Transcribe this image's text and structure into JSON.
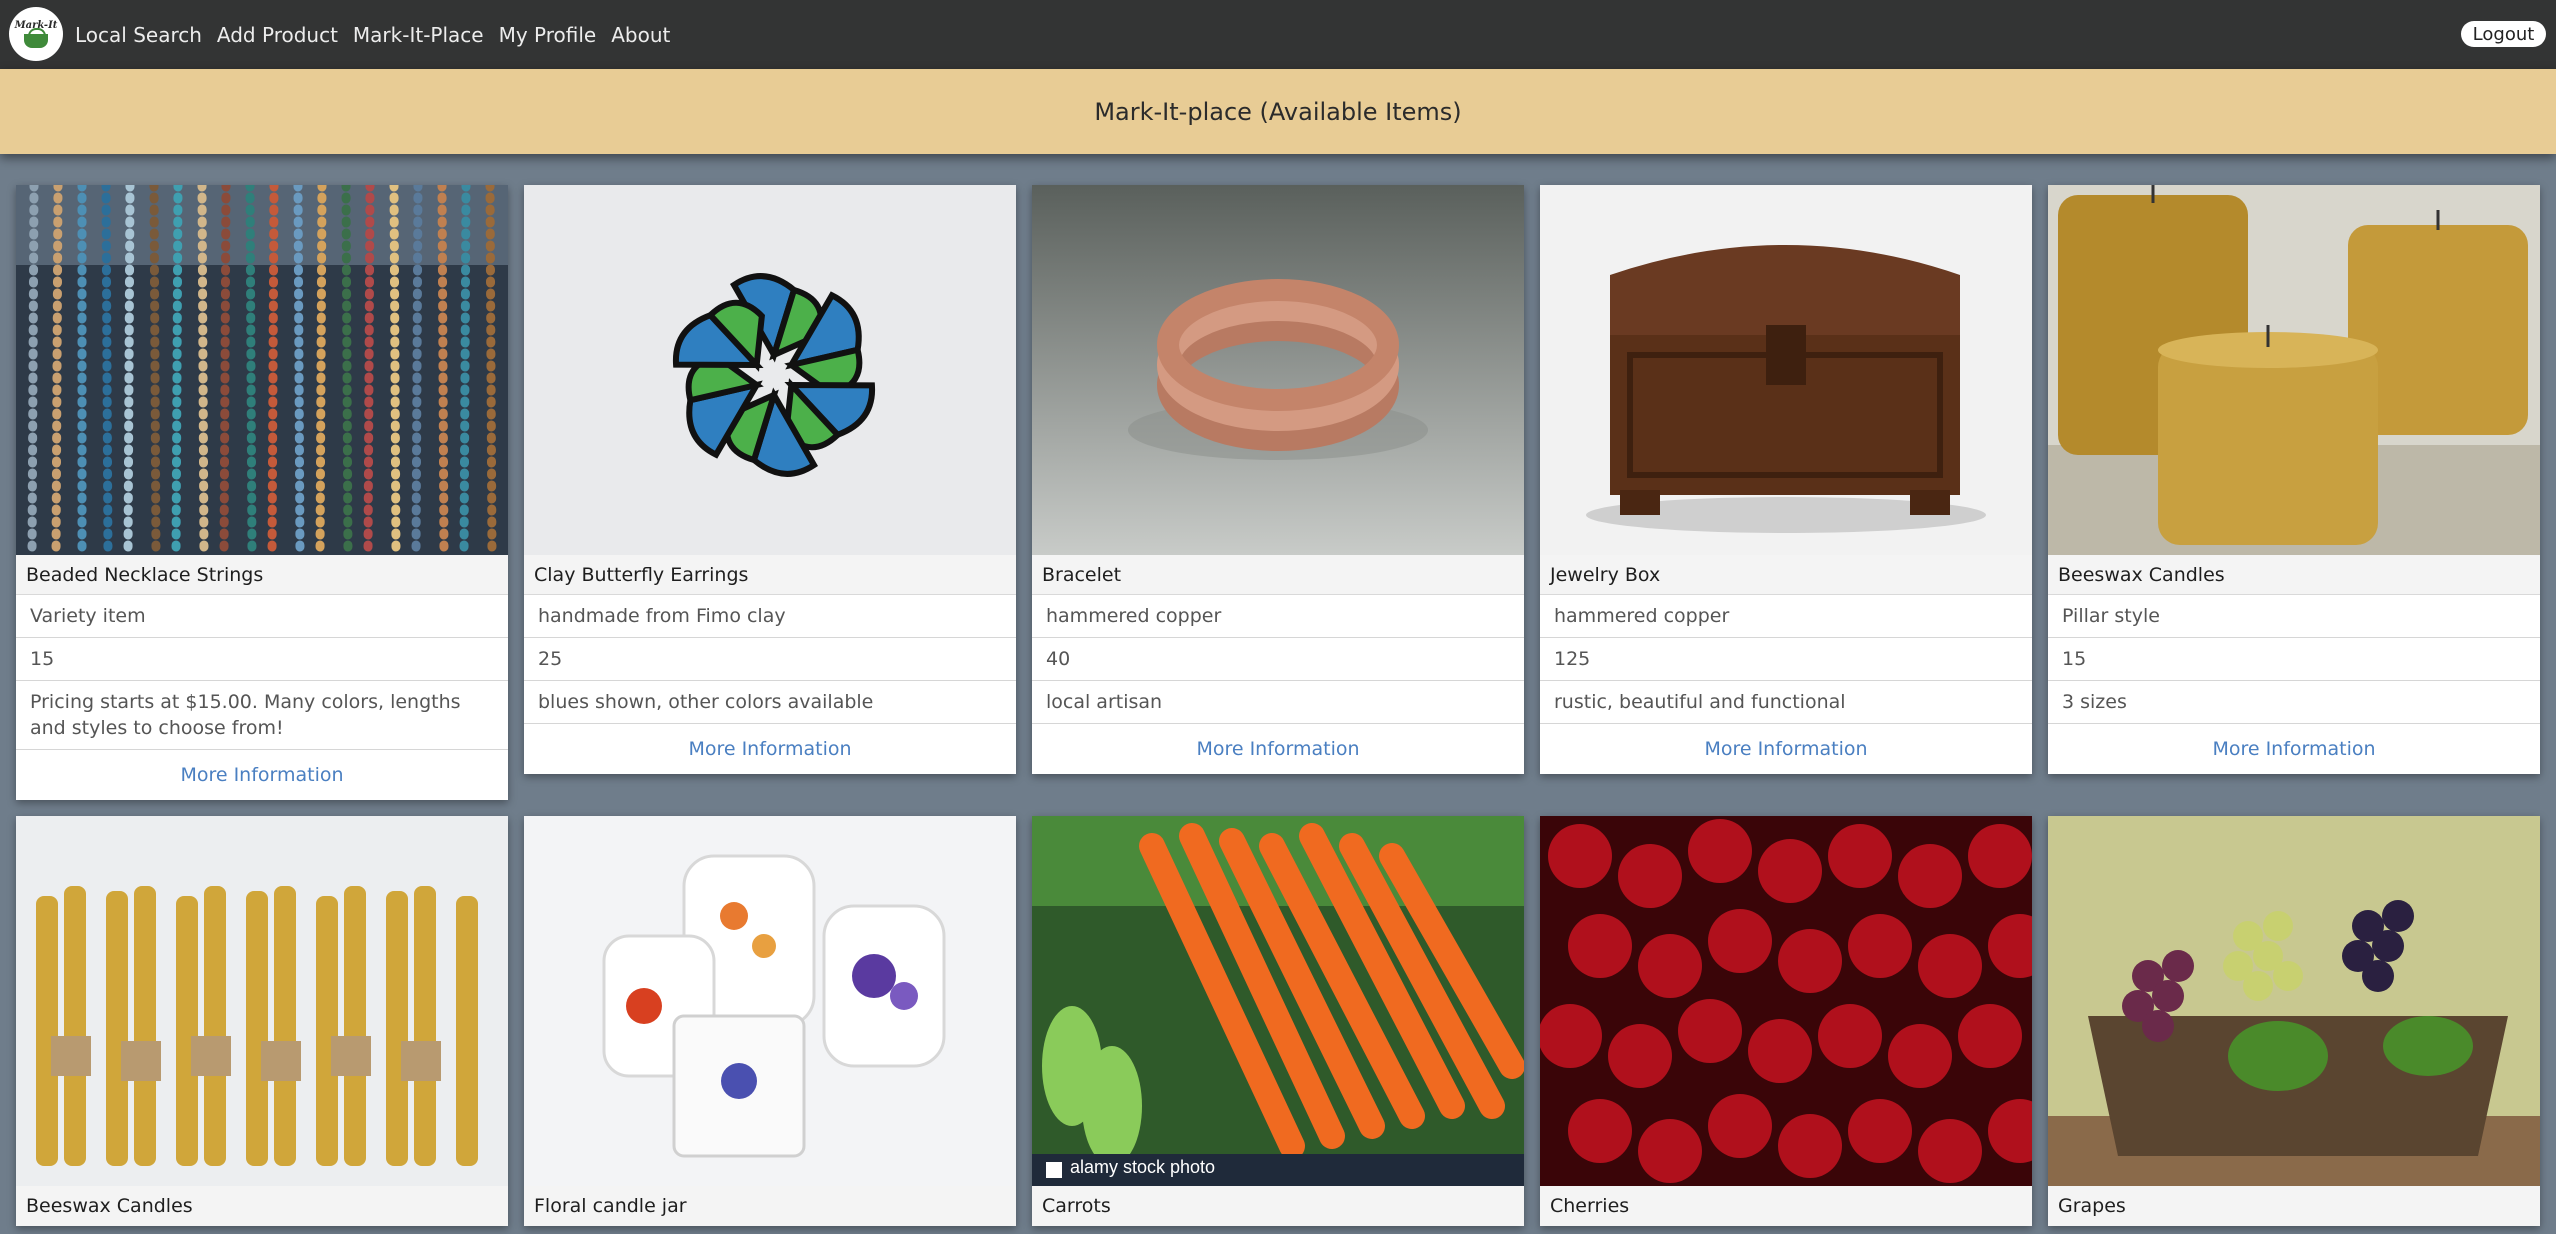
{
  "nav": {
    "logo_text": "Mark-It",
    "links": [
      "Local Search",
      "Add Product",
      "Mark-It-Place",
      "My Profile",
      "About"
    ],
    "logout": "Logout"
  },
  "header": {
    "title": "Mark-It-place (Available Items)"
  },
  "colors": {
    "navbar": "#333434",
    "header_band": "#e8cc95",
    "page_bg": "#6f7d8b",
    "link_blue": "#4a7fc1"
  },
  "products": [
    {
      "name": "Beaded Necklace Strings",
      "description": "Variety item",
      "quantity": "15",
      "notes": "Pricing starts at $15.00. Many colors, lengths and styles to choose from!",
      "more": "More Information"
    },
    {
      "name": "Clay Butterfly Earrings",
      "description": "handmade from Fimo clay",
      "quantity": "25",
      "notes": "blues shown, other colors available",
      "more": "More Information"
    },
    {
      "name": "Bracelet",
      "description": "hammered copper",
      "quantity": "40",
      "notes": "local artisan",
      "more": "More Information"
    },
    {
      "name": "Jewelry Box",
      "description": "hammered copper",
      "quantity": "125",
      "notes": "rustic, beautiful and functional",
      "more": "More Information"
    },
    {
      "name": "Beeswax Candles",
      "description": "Pillar style",
      "quantity": "15",
      "notes": "3 sizes",
      "more": "More Information"
    },
    {
      "name": "Beeswax Candles"
    },
    {
      "name": "Floral candle jar"
    },
    {
      "name": "Carrots",
      "watermark": "alamy stock photo"
    },
    {
      "name": "Cherries"
    },
    {
      "name": "Grapes"
    }
  ]
}
